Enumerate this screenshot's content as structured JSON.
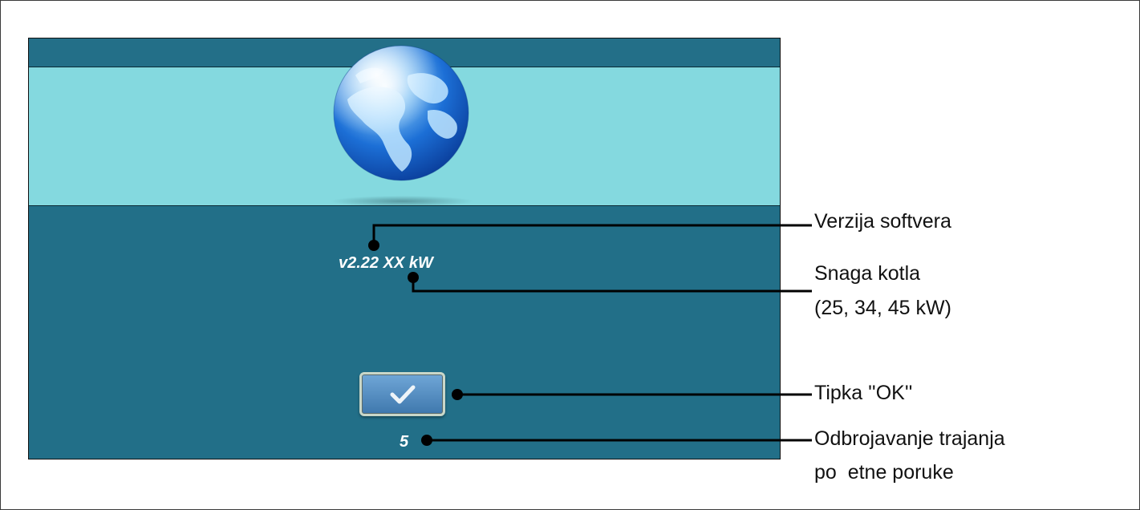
{
  "screen": {
    "version_text": "v2.22 XX kW",
    "countdown": "5",
    "ok_button_icon": "checkmark-icon"
  },
  "annotations": {
    "software_version": "Verzija softvera",
    "boiler_power_line1": "Snaga kotla",
    "boiler_power_line2": "(25, 34, 45 kW)",
    "ok_key": "Tipka ''OK''",
    "countdown_line1": "Odbrojavanje trajanja",
    "countdown_line2": "po  etne poruke"
  },
  "colors": {
    "screen_bg": "#226f88",
    "globe_band": "#84d9df",
    "button": "#4f8cc2"
  }
}
